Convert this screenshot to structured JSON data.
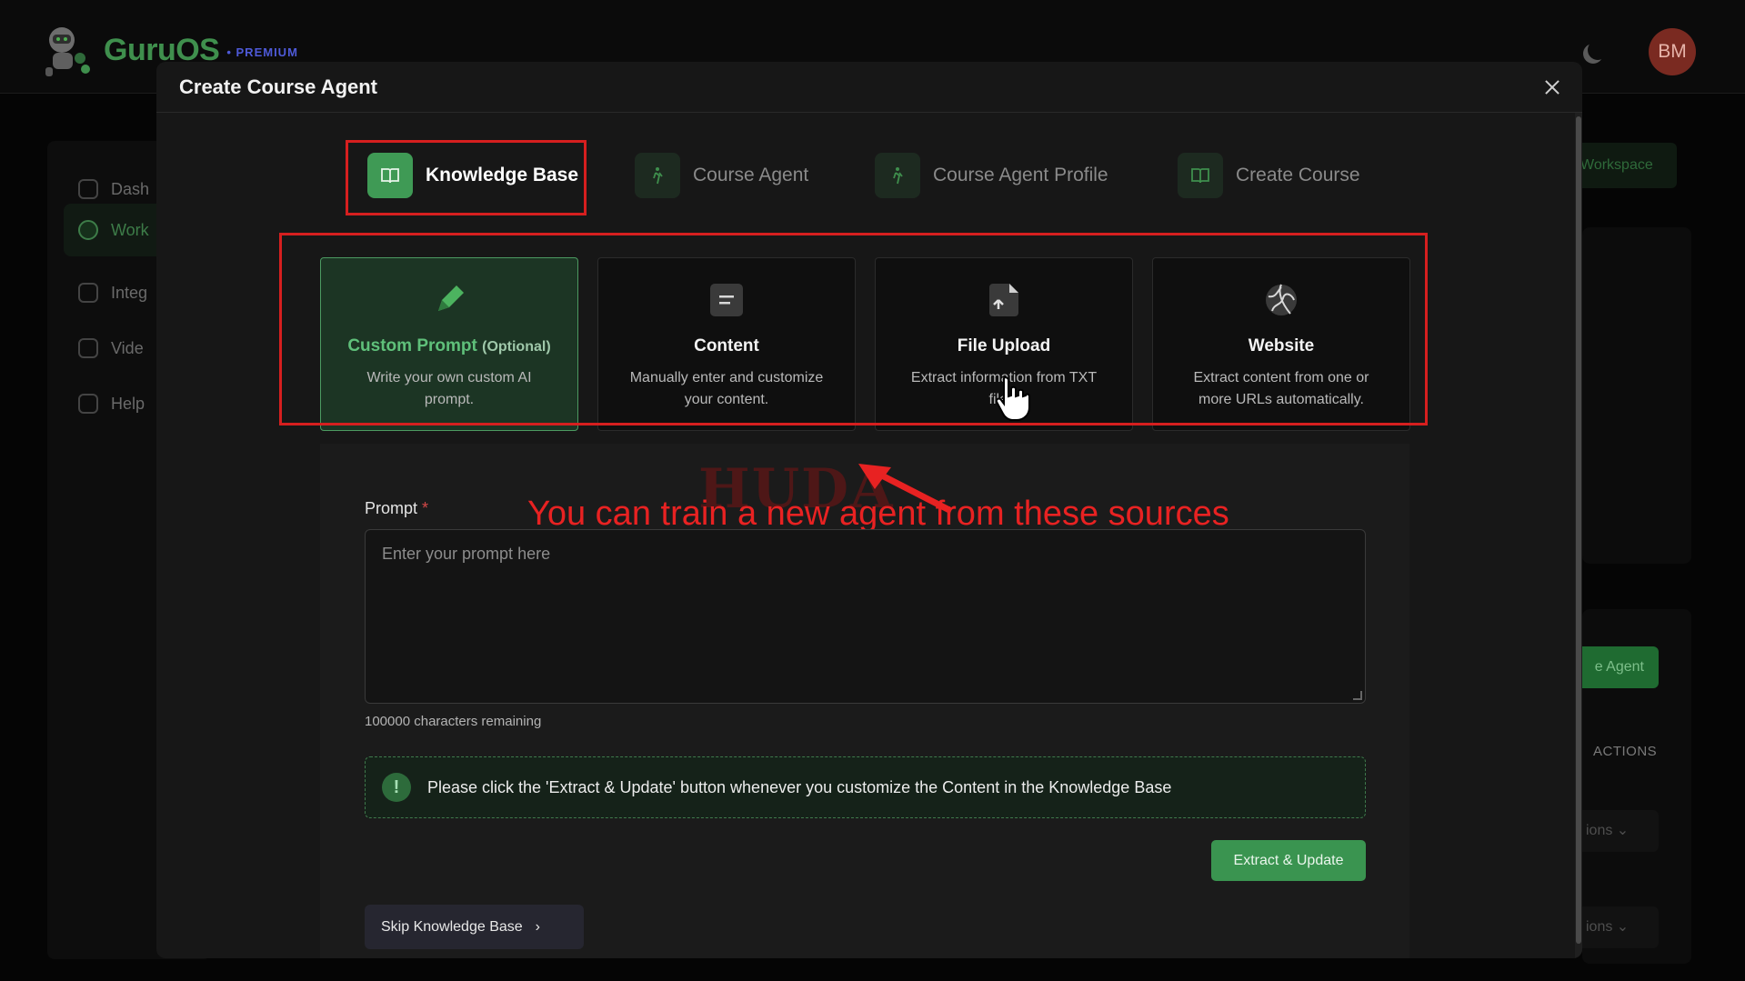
{
  "app": {
    "name": "GuruOS",
    "badge": "• PREMIUM",
    "avatar_initials": "BM"
  },
  "sidebar": {
    "items": [
      {
        "label": "Dash",
        "icon": "home-icon"
      },
      {
        "label": "Work",
        "icon": "layers-icon"
      },
      {
        "label": "Integ",
        "icon": "gear-icon"
      },
      {
        "label": "Vide",
        "icon": "video-icon"
      },
      {
        "label": "Help",
        "icon": "chat-icon"
      }
    ]
  },
  "background": {
    "workspace_label": "Workspace",
    "agent_button": "e Agent",
    "actions_header": "ACTIONS",
    "options_1": "ions",
    "options_2": "ions"
  },
  "modal": {
    "title": "Create Course Agent",
    "steps": [
      {
        "label": "Knowledge Base",
        "icon": "book-icon"
      },
      {
        "label": "Course Agent",
        "icon": "figure-icon"
      },
      {
        "label": "Course Agent Profile",
        "icon": "figure-icon"
      },
      {
        "label": "Create Course",
        "icon": "book-icon"
      }
    ],
    "sources": [
      {
        "title": "Custom Prompt",
        "optional": "(Optional)",
        "desc": "Write your own custom AI prompt.",
        "icon": "pencil-icon"
      },
      {
        "title": "Content",
        "desc": "Manually enter and customize your content.",
        "icon": "document-icon"
      },
      {
        "title": "File Upload",
        "desc": "Extract information from TXT files.",
        "icon": "upload-file-icon"
      },
      {
        "title": "Website",
        "desc": "Extract content from one or more URLs automatically.",
        "icon": "globe-icon"
      }
    ],
    "prompt": {
      "label": "Prompt",
      "required_mark": "*",
      "placeholder": "Enter your prompt here",
      "chars_remaining": "100000 characters remaining"
    },
    "notice": "Please click the 'Extract & Update' button whenever you customize the Content in the Knowledge Base",
    "notice_icon": "!",
    "extract_button": "Extract & Update",
    "skip_button": "Skip Knowledge Base"
  },
  "annotation": {
    "text": "You can train a new agent from these sources",
    "watermark": "HUDA"
  },
  "colors": {
    "accent": "#3f9a55",
    "annotation": "#e82222"
  }
}
